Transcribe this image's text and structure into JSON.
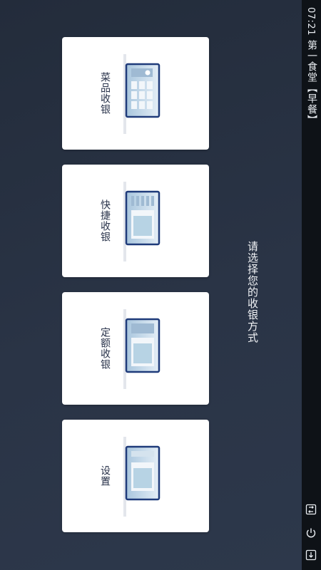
{
  "status": {
    "time": "07:21",
    "title": "第一食堂【早餐】"
  },
  "prompt": "请选择您的收银方式",
  "cards": [
    {
      "label": "菜品收银",
      "icon": "dish-register-icon"
    },
    {
      "label": "快捷收银",
      "icon": "quick-register-icon"
    },
    {
      "label": "定额收银",
      "icon": "fixed-amount-register-icon"
    },
    {
      "label": "设置",
      "icon": "settings-screen-icon"
    }
  ],
  "nav": {
    "recent_icon": "recent-apps-icon",
    "power_icon": "power-icon",
    "back_icon": "download-icon"
  },
  "colors": {
    "background": "#262f3f",
    "card": "#ffffff",
    "label": "#28324a",
    "illustration_frame": "#1f3b7a",
    "illustration_fill": "#c6dbe9"
  }
}
